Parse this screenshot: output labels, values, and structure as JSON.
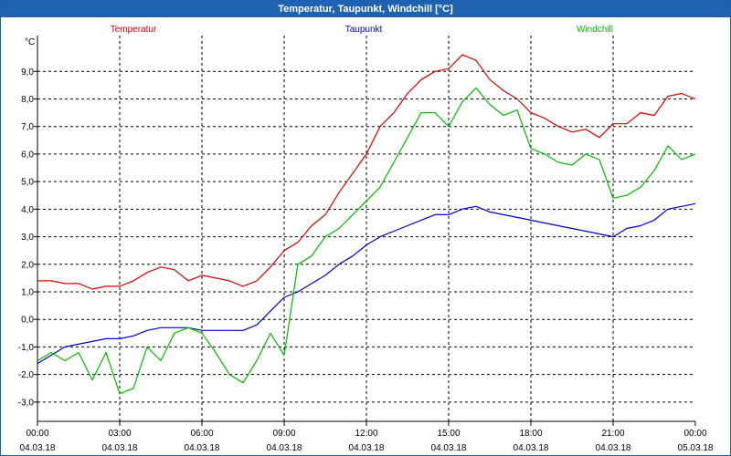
{
  "window": {
    "title": "Temperatur, Taupunkt, Windchill [°C]"
  },
  "colors": {
    "temperatur": "#dd0000",
    "taupunkt": "#0000cc",
    "windchill": "#00bb00",
    "titlebar": "#1f63b0"
  },
  "chart_data": {
    "type": "line",
    "title": "Temperatur, Taupunkt, Windchill [°C]",
    "ylabel": "°C",
    "xlabel": "",
    "ylim": [
      -3.7,
      10.3
    ],
    "xlim": [
      0,
      24
    ],
    "grid": true,
    "legend_placement": "top",
    "yticks": [
      -3.0,
      -2.0,
      -1.0,
      0.0,
      1.0,
      2.0,
      3.0,
      4.0,
      5.0,
      6.0,
      7.0,
      8.0,
      9.0
    ],
    "ytick_labels": [
      "-3,0",
      "-2,0",
      "-1,0",
      "0,0",
      "1,0",
      "2,0",
      "3,0",
      "4,0",
      "5,0",
      "6,0",
      "7,0",
      "8,0",
      "9,0"
    ],
    "xticks": [
      {
        "x": 0,
        "time": "00:00",
        "date": "04.03.18"
      },
      {
        "x": 3,
        "time": "03:00",
        "date": "04.03.18"
      },
      {
        "x": 6,
        "time": "06:00",
        "date": "04.03.18"
      },
      {
        "x": 9,
        "time": "09:00",
        "date": "04.03.18"
      },
      {
        "x": 12,
        "time": "12:00",
        "date": "04.03.18"
      },
      {
        "x": 15,
        "time": "15:00",
        "date": "04.03.18"
      },
      {
        "x": 18,
        "time": "18:00",
        "date": "04.03.18"
      },
      {
        "x": 21,
        "time": "21:00",
        "date": "04.03.18"
      },
      {
        "x": 24,
        "time": "00:00",
        "date": "05.03.18"
      }
    ],
    "series": [
      {
        "name": "Temperatur",
        "color": "#dd0000",
        "x": [
          0,
          0.5,
          1,
          1.5,
          2,
          2.5,
          3,
          3.5,
          4,
          4.5,
          5,
          5.5,
          6,
          6.5,
          7,
          7.5,
          8,
          8.5,
          9,
          9.5,
          10,
          10.5,
          11,
          11.5,
          12,
          12.5,
          13,
          13.5,
          14,
          14.5,
          15,
          15.5,
          16,
          16.5,
          17,
          17.5,
          18,
          18.5,
          19,
          19.5,
          20,
          20.5,
          21,
          21.5,
          22,
          22.5,
          23,
          23.5,
          24
        ],
        "values": [
          1.4,
          1.4,
          1.3,
          1.3,
          1.1,
          1.2,
          1.2,
          1.4,
          1.7,
          1.9,
          1.8,
          1.4,
          1.6,
          1.5,
          1.4,
          1.2,
          1.4,
          1.9,
          2.5,
          2.8,
          3.4,
          3.8,
          4.6,
          5.3,
          6.0,
          7.0,
          7.5,
          8.2,
          8.7,
          9.0,
          9.1,
          9.6,
          9.4,
          8.7,
          8.3,
          8.0,
          7.5,
          7.3,
          7.0,
          6.8,
          6.9,
          6.6,
          7.1,
          7.1,
          7.5,
          7.4,
          8.1,
          8.2,
          8.0
        ]
      },
      {
        "name": "Taupunkt",
        "color": "#0000cc",
        "x": [
          0,
          0.5,
          1,
          1.5,
          2,
          2.5,
          3,
          3.5,
          4,
          4.5,
          5,
          5.5,
          6,
          6.5,
          7,
          7.5,
          8,
          8.5,
          9,
          9.5,
          10,
          10.5,
          11,
          11.5,
          12,
          12.5,
          13,
          13.5,
          14,
          14.5,
          15,
          15.5,
          16,
          16.5,
          17,
          17.5,
          18,
          18.5,
          19,
          19.5,
          20,
          20.5,
          21,
          21.5,
          22,
          22.5,
          23,
          23.5,
          24
        ],
        "values": [
          -1.6,
          -1.3,
          -1.0,
          -0.9,
          -0.8,
          -0.7,
          -0.7,
          -0.6,
          -0.4,
          -0.3,
          -0.3,
          -0.3,
          -0.4,
          -0.4,
          -0.4,
          -0.4,
          -0.2,
          0.3,
          0.8,
          1.0,
          1.3,
          1.6,
          2.0,
          2.3,
          2.7,
          3.0,
          3.2,
          3.4,
          3.6,
          3.8,
          3.8,
          4.0,
          4.1,
          3.9,
          3.8,
          3.7,
          3.6,
          3.5,
          3.4,
          3.3,
          3.2,
          3.1,
          3.0,
          3.3,
          3.4,
          3.6,
          4.0,
          4.1,
          4.2
        ]
      },
      {
        "name": "Windchill",
        "color": "#00bb00",
        "x": [
          0,
          0.5,
          1,
          1.5,
          2,
          2.5,
          3,
          3.5,
          4,
          4.5,
          5,
          5.5,
          6,
          6.5,
          7,
          7.5,
          8,
          8.5,
          9,
          9.5,
          10,
          10.5,
          11,
          11.5,
          12,
          12.5,
          13,
          13.5,
          14,
          14.5,
          15,
          15.5,
          16,
          16.5,
          17,
          17.5,
          18,
          18.5,
          19,
          19.5,
          20,
          20.5,
          21,
          21.5,
          22,
          22.5,
          23,
          23.5,
          24
        ],
        "values": [
          -1.5,
          -1.2,
          -1.5,
          -1.2,
          -2.2,
          -1.2,
          -2.7,
          -2.5,
          -1.0,
          -1.5,
          -0.5,
          -0.3,
          -0.5,
          -1.2,
          -2.0,
          -2.3,
          -1.5,
          -0.5,
          -1.3,
          2.0,
          2.3,
          3.0,
          3.3,
          3.8,
          4.3,
          4.8,
          5.7,
          6.6,
          7.5,
          7.5,
          7.0,
          7.9,
          8.4,
          7.8,
          7.4,
          7.6,
          6.2,
          6.0,
          5.7,
          5.6,
          6.0,
          5.8,
          4.4,
          4.5,
          4.8,
          5.4,
          6.3,
          5.8,
          6.0
        ]
      }
    ]
  }
}
